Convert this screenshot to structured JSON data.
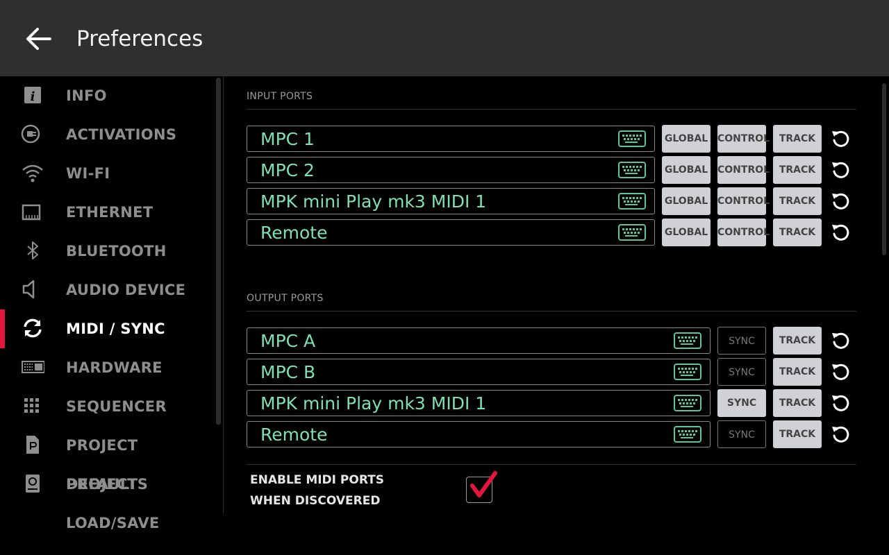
{
  "header": {
    "title": "Preferences"
  },
  "sidebar": {
    "items": [
      {
        "label": "INFO",
        "icon": "info-icon"
      },
      {
        "label": "ACTIVATIONS",
        "icon": "plug-icon"
      },
      {
        "label": "WI-FI",
        "icon": "wifi-icon"
      },
      {
        "label": "ETHERNET",
        "icon": "ethernet-icon"
      },
      {
        "label": "BLUETOOTH",
        "icon": "bluetooth-icon"
      },
      {
        "label": "AUDIO DEVICE",
        "icon": "speaker-icon"
      },
      {
        "label": "MIDI / SYNC",
        "icon": "sync-icon",
        "active": true
      },
      {
        "label": "HARDWARE",
        "icon": "hardware-icon"
      },
      {
        "label": "SEQUENCER",
        "icon": "grid-icon"
      },
      {
        "label": "PROJECT DEFAULTS",
        "icon": "document-icon"
      },
      {
        "label": "PROJECT LOAD/SAVE",
        "icon": "drive-icon"
      }
    ]
  },
  "input_ports": {
    "title": "INPUT PORTS",
    "buttons": {
      "global": "GLOBAL",
      "control": "CONTROL",
      "track": "TRACK"
    },
    "ports": [
      {
        "name": "MPC 1",
        "global": true,
        "control": true,
        "track": true
      },
      {
        "name": "MPC 2",
        "global": true,
        "control": true,
        "track": true
      },
      {
        "name": "MPK mini Play mk3 MIDI 1",
        "global": true,
        "control": true,
        "track": true
      },
      {
        "name": "Remote",
        "global": true,
        "control": true,
        "track": true
      }
    ]
  },
  "output_ports": {
    "title": "OUTPUT PORTS",
    "buttons": {
      "sync": "SYNC",
      "track": "TRACK"
    },
    "ports": [
      {
        "name": "MPC A",
        "sync": false,
        "track": true
      },
      {
        "name": "MPC B",
        "sync": false,
        "track": true
      },
      {
        "name": "MPK mini Play mk3 MIDI 1",
        "sync": true,
        "track": true
      },
      {
        "name": "Remote",
        "sync": false,
        "track": true
      }
    ]
  },
  "enable_midi": {
    "line1": "ENABLE MIDI PORTS",
    "line2": "WHEN DISCOVERED",
    "checked": true
  },
  "colors": {
    "accent": "#e3173e",
    "port_name": "#7fe0b2",
    "button_on": "#cfd1d4",
    "header_bg": "#2f2f2f"
  }
}
